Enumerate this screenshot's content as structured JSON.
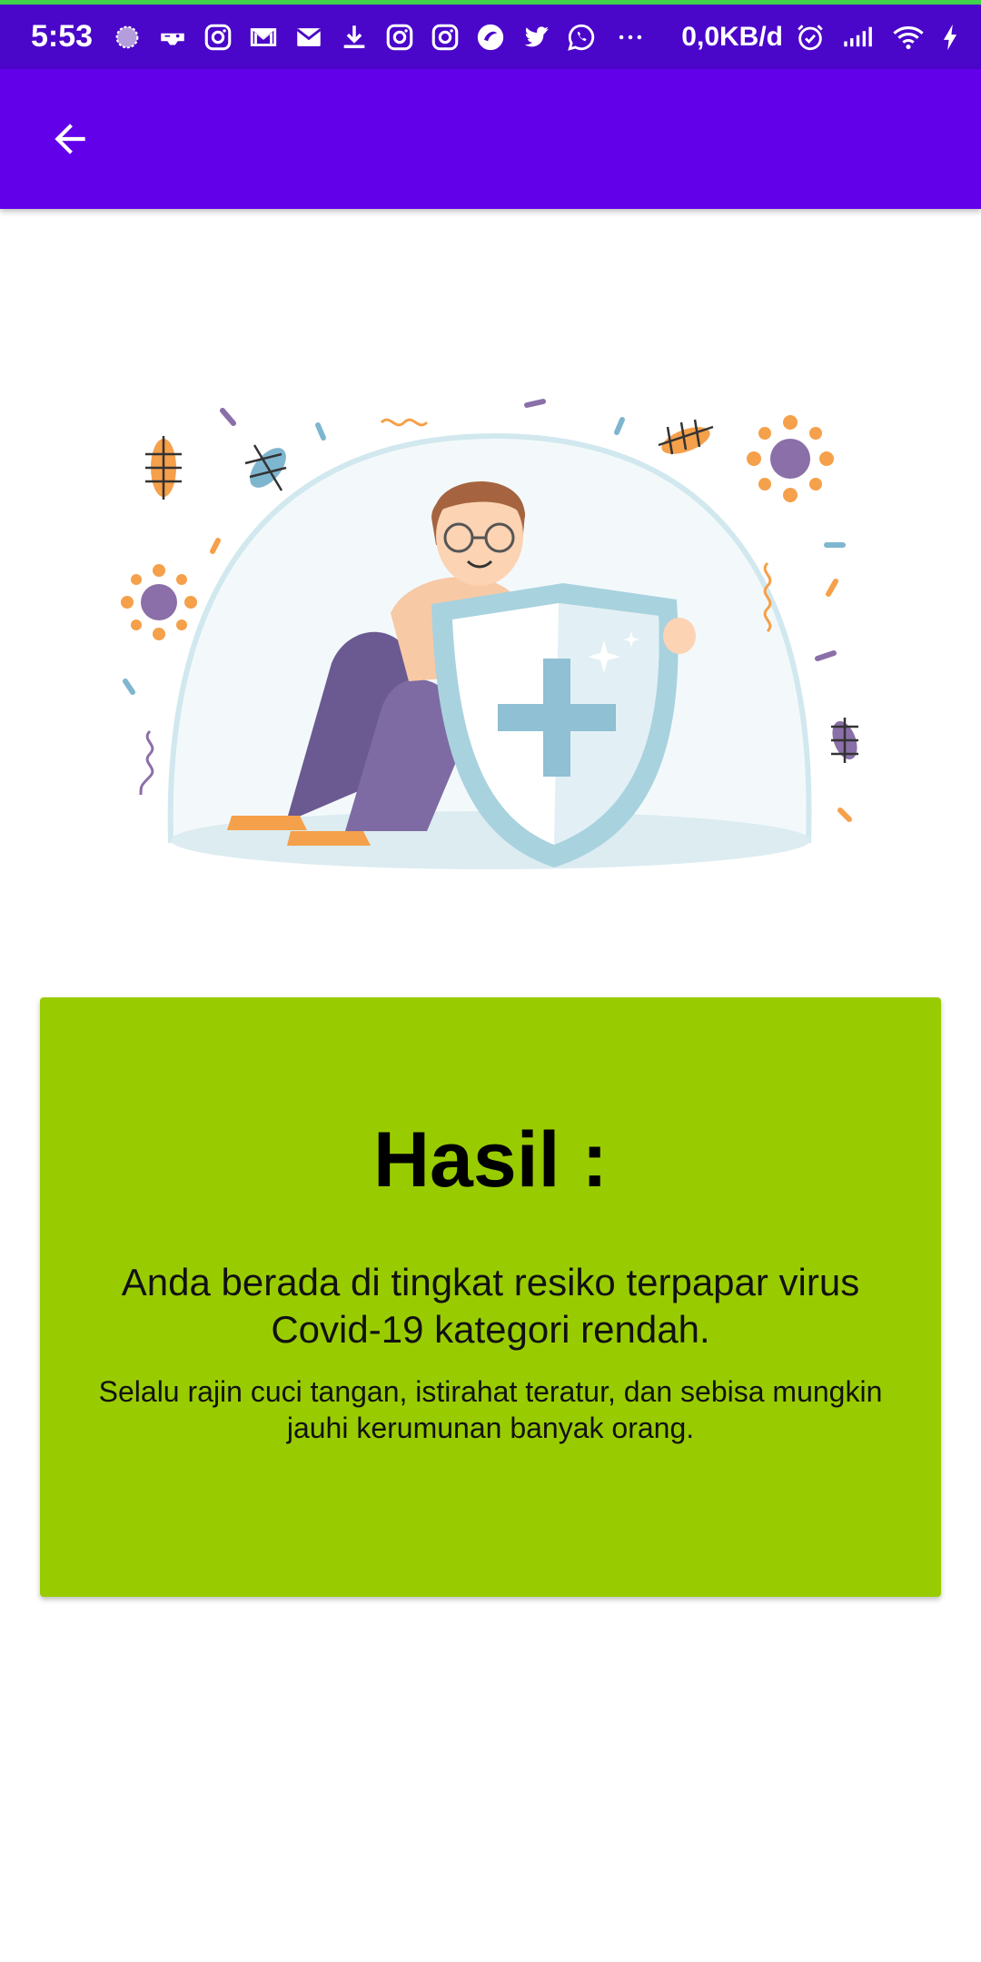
{
  "status_bar": {
    "time": "5:53",
    "network_speed": "0,0KB/d",
    "icons": [
      "assistant-icon",
      "game-controller-icon",
      "instagram-icon",
      "gmail-icon",
      "mail-icon",
      "download-icon",
      "instagram-icon",
      "instagram-icon",
      "browser-icon",
      "twitter-icon",
      "whatsapp-icon",
      "more-dots-icon",
      "alarm-icon",
      "signal-icon",
      "wifi-icon",
      "charging-icon"
    ],
    "colors": {
      "background": "#4a06c9",
      "accent_line": "#3fd24a"
    }
  },
  "app_bar": {
    "back_icon": "arrow-back-icon",
    "color": "#6200ea"
  },
  "illustration": {
    "icon": "protected-person-shield-illustration"
  },
  "result": {
    "title": "Hasil :",
    "message": "Anda berada di tingkat resiko terpapar virus Covid-19 kategori rendah.",
    "advice": "Selalu rajin cuci tangan, istirahat teratur, dan sebisa mungkin jauhi kerumunan banyak orang.",
    "card_color": "#99cc00"
  }
}
